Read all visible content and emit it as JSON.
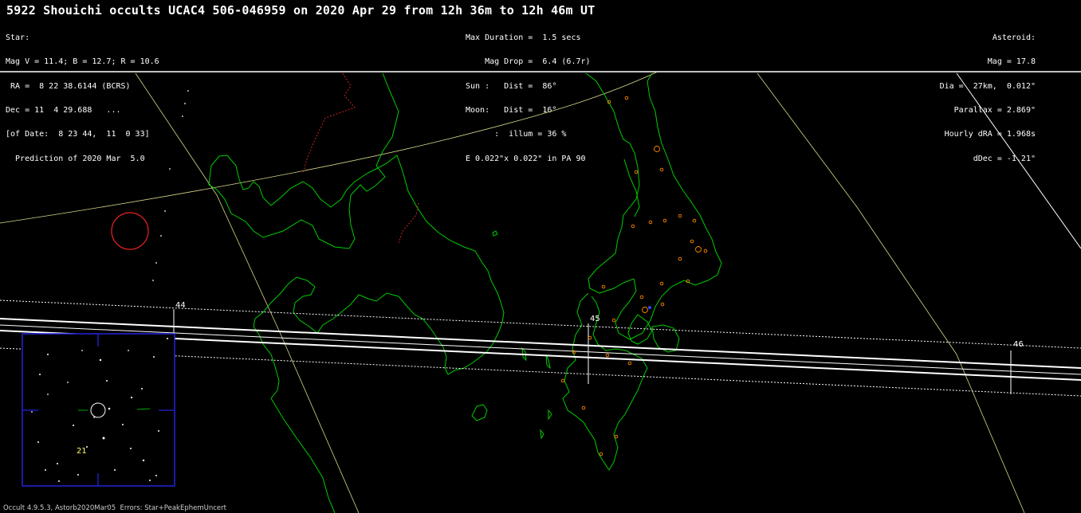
{
  "title": "5922 Shouichi occults UCAC4 506-046959 on 2020 Apr 29 from 12h 36m to 12h 46m UT",
  "star": {
    "heading": "Star:",
    "mags": "Mag V = 11.4; B = 12.7; R = 10.6",
    "ra": " RA =  8 22 38.6144 (BCRS)",
    "dec": "Dec = 11  4 29.688   ...",
    "of_date": "[of Date:  8 23 44,  11  0 33]",
    "prediction": "  Prediction of 2020 Mar  5.0"
  },
  "circumstances": {
    "max_duration": "Max Duration =  1.5 secs",
    "mag_drop": "    Mag Drop =  6.4 (6.7r)",
    "sun": "Sun :   Dist =  86°",
    "moon_dist": "Moon:   Dist =  16°",
    "moon_illum": "      :  illum = 36 %",
    "ellipse": "E 0.022\"x 0.022\" in PA 90"
  },
  "asteroid": {
    "heading": "Asteroid:",
    "mag": "Mag = 17.8",
    "dia": "Dia =  27km,  0.012\"",
    "parallax": "Parallax = 2.869\"",
    "hourly_dra": "Hourly dRA = 1.968s",
    "ddec": "dDec = -1.21\""
  },
  "path_time_labels": [
    "44",
    "45",
    "46"
  ],
  "star_chart_label": "21",
  "footer": "Occult 4.9.5.3, Astorb2020Mar05  Errors: Star+PeakEphemUncert",
  "colors": {
    "background": "#000000",
    "coastline": "#00cc00",
    "border": "#cc2222",
    "path_line": "#ffffff",
    "grid": "#d8d88a",
    "chart_frame": "#2222dd",
    "site": "#ff8800"
  }
}
